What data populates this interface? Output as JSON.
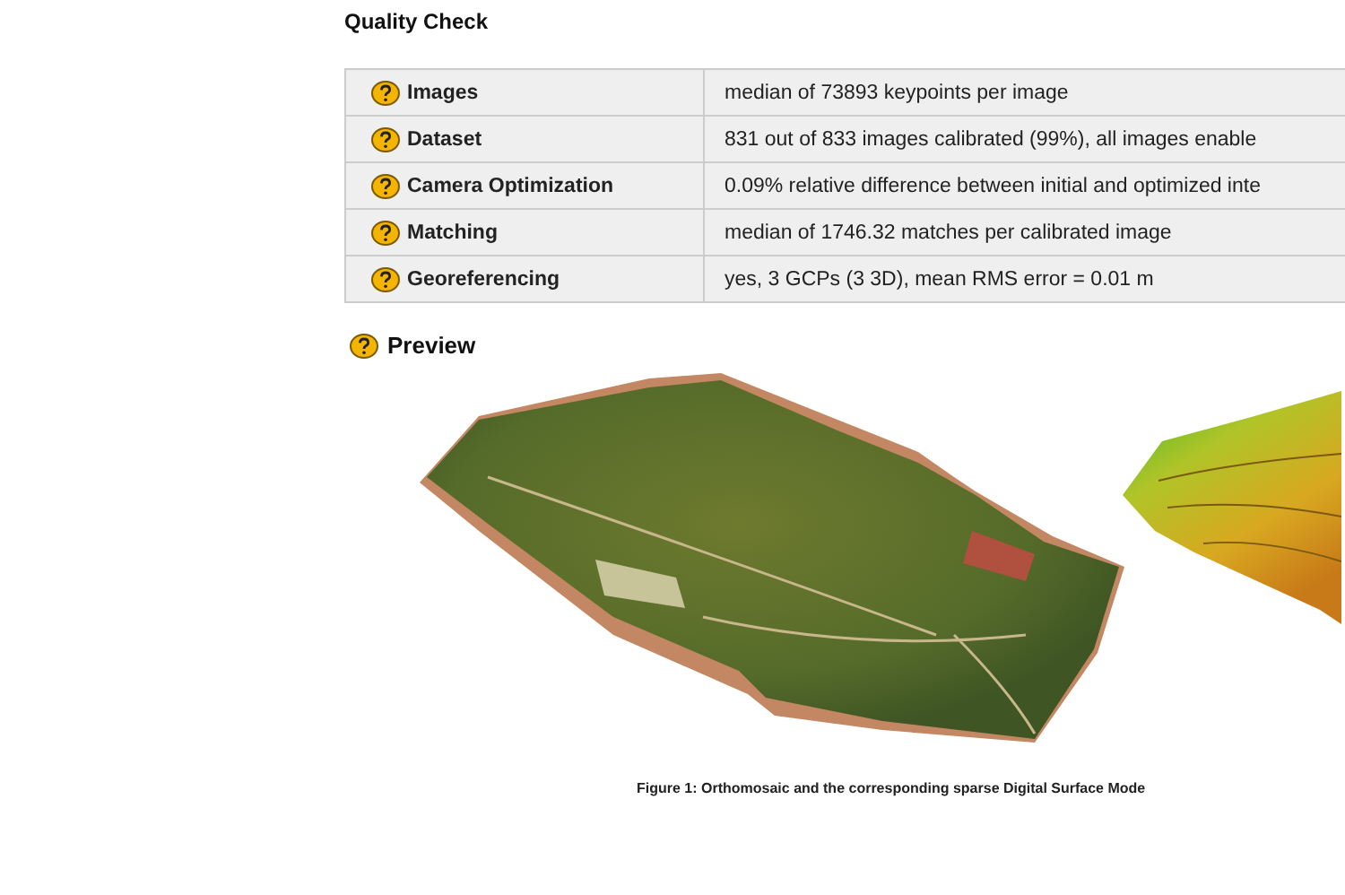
{
  "section_title": "Quality Check",
  "quality_rows": [
    {
      "label": "Images",
      "value": "median of 73893 keypoints per image"
    },
    {
      "label": "Dataset",
      "value": "831 out of 833 images calibrated (99%), all images enable"
    },
    {
      "label": "Camera Optimization",
      "value": "0.09% relative difference between initial and optimized inte"
    },
    {
      "label": "Matching",
      "value": "median of 1746.32 matches per calibrated image"
    },
    {
      "label": "Georeferencing",
      "value": "yes, 3 GCPs (3 3D), mean RMS error = 0.01 m"
    }
  ],
  "preview": {
    "title": "Preview",
    "caption": "Figure 1: Orthomosaic and the corresponding sparse Digital Surface Mode"
  }
}
